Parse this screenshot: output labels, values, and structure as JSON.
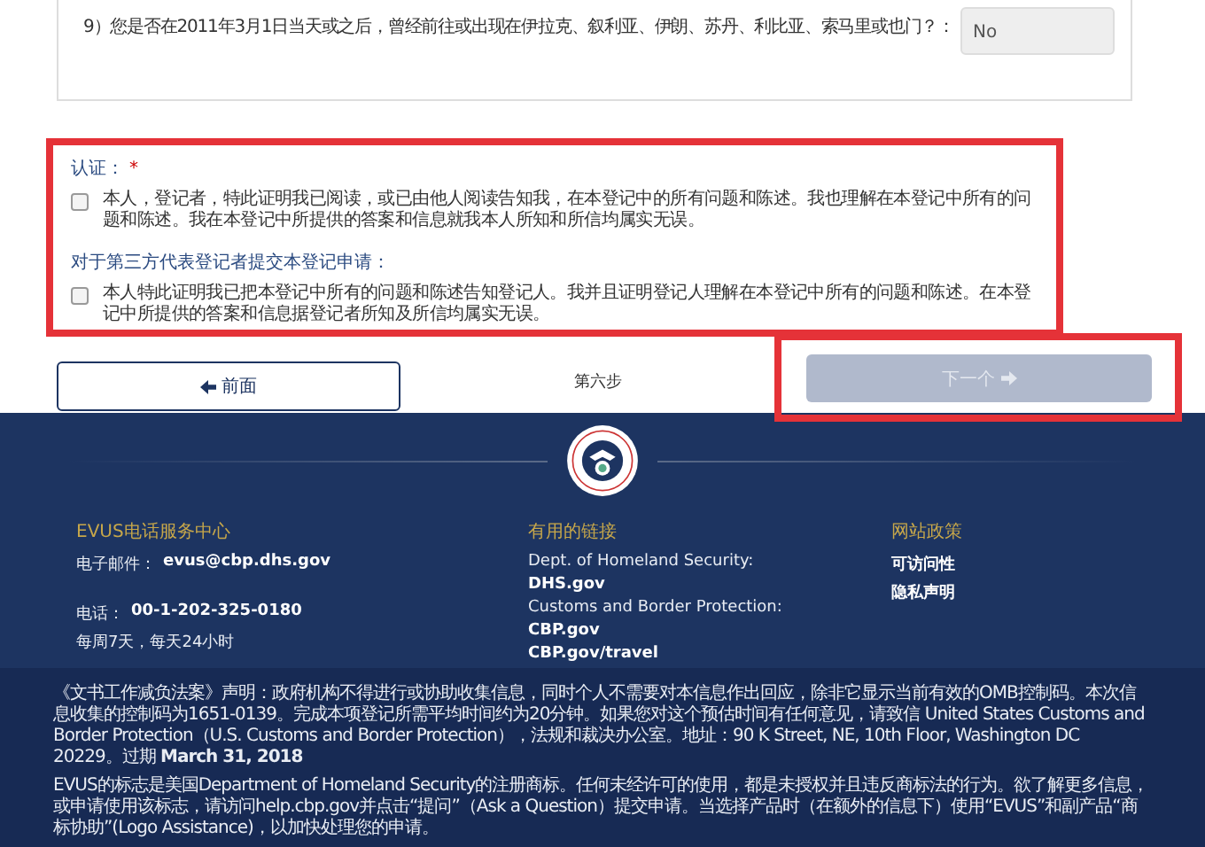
{
  "question": {
    "text": "9）您是否在2011年3月1日当天或之后，曾经前往或出现在伊拉克、叙利亚、伊朗、苏丹、利比亚、索马里或也门？：",
    "answer": "No"
  },
  "certification": {
    "title": "认证：",
    "required_mark": "*",
    "items": [
      {
        "text": "本人，登记者，特此证明我已阅读，或已由他人阅读告知我，在本登记中的所有问题和陈述。我也理解在本登记中所有的问题和陈述。我在本登记中所提供的答案和信息就我本人所知和所信均属实无误。",
        "checked": false
      }
    ],
    "third_party_title": "对于第三方代表登记者提交本登记申请：",
    "third_party_items": [
      {
        "text": "本人特此证明我已把本登记中所有的问题和陈述告知登记人。我并且证明登记人理解在本登记中所有的问题和陈述。在本登记中所提供的答案和信息据登记者所知及所信均属实无误。",
        "checked": false
      }
    ]
  },
  "nav": {
    "previous": "前面",
    "step": "第六步",
    "next": "下一个",
    "next_disabled": true
  },
  "footer": {
    "columns": [
      {
        "title": "EVUS电话服务中心",
        "lines": [
          {
            "label": "电子邮件：",
            "value": "evus@cbp.dhs.gov"
          },
          {
            "label": "电话：",
            "value": "00-1-202-325-0180"
          },
          {
            "label": "每周7天，每天24小时"
          }
        ]
      },
      {
        "title": "有用的链接",
        "lines": [
          {
            "label": "Dept. of Homeland Security:",
            "value": "DHS.gov"
          },
          {
            "label": "Customs and Border Protection:",
            "value": "CBP.gov"
          },
          {
            "value": "CBP.gov/travel"
          }
        ]
      },
      {
        "title": "网站政策",
        "lines": [
          {
            "value": "可访问性"
          },
          {
            "value": "隐私声明"
          }
        ]
      }
    ],
    "legal": [
      "《文书工作减负法案》声明：政府机构不得进行或协助收集信息，同时个人不需要对本信息作出回应，除非它显示当前有效的OMB控制码。本次信息收集的控制码为1651-0139。完成本项登记所需平均时间约为20分钟。如果您对这个预估时间有任何意见，请致信 United States Customs and Border Protection（U.S. Customs and Border Protection），法规和裁决办公室。地址：90 K Street, NE, 10th Floor, Washington DC 20229。过期 **March 31, 2018**",
      "EVUS的标志是美国Department of Homeland Security的注册商标。任何未经许可的使用，都是未授权并且违反商标法的行为。欲了解更多信息，或申请使用该标志，请访问help.cbp.gov并点击“提问”（Ask a Question）提交申请。当选择产品时（在额外的信息下）使用“EVUS”和副产品“商标协助”(Logo Assistance)，以加快处理您的申请。"
    ]
  }
}
